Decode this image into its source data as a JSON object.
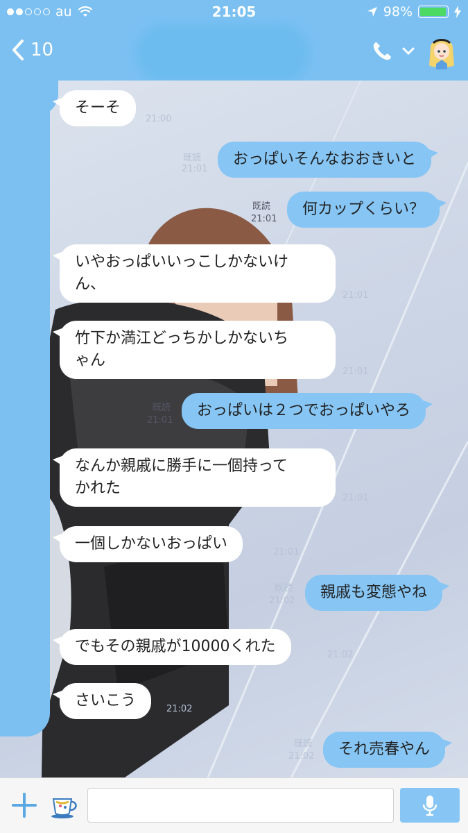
{
  "status_bar": {
    "carrier": "au",
    "signal_bars_filled": 2,
    "signal_bars_total": 5,
    "time": "21:05",
    "battery": "98%",
    "battery_level": 0.98
  },
  "header": {
    "back_count": "10"
  },
  "messages": [
    {
      "dir": "in",
      "text": "そーそ",
      "time": "21:00",
      "read": ""
    },
    {
      "dir": "out",
      "text": "おっぱいそんなおおきいと",
      "time": "21:01",
      "read": "既読"
    },
    {
      "dir": "out",
      "text": "何カップくらい？",
      "time": "21:01",
      "read": "既読"
    },
    {
      "dir": "in",
      "text": "いやおっぱいいっこしかないけ\nん、",
      "time": "21:01",
      "read": ""
    },
    {
      "dir": "in",
      "text": "竹下か満江どっちかしかないち\nゃん",
      "time": "21:01",
      "read": ""
    },
    {
      "dir": "out",
      "text": "おっぱいは２つでおっぱいやろ",
      "time": "21:01",
      "read": "既読"
    },
    {
      "dir": "in",
      "text": "なんか親戚に勝手に一個持って\nかれた",
      "time": "21:01",
      "read": ""
    },
    {
      "dir": "in",
      "text": "一個しかないおっぱい",
      "time": "21:01",
      "read": ""
    },
    {
      "dir": "out",
      "text": "親戚も変態やね",
      "time": "21:02",
      "read": "既読"
    },
    {
      "dir": "in",
      "text": "でもその親戚が10000くれた",
      "time": "21:02",
      "read": ""
    },
    {
      "dir": "in",
      "text": "さいこう",
      "time": "21:02",
      "read": ""
    },
    {
      "dir": "out",
      "text": "それ売春やん",
      "time": "21:02",
      "read": "既読"
    }
  ],
  "input_bar": {
    "placeholder": ""
  },
  "icons": {
    "back": "chevron-left-icon",
    "phone": "phone-icon",
    "menu": "chevron-down-icon",
    "avatar": "alice-avatar-icon",
    "plus": "plus-icon",
    "sticker": "teacup-sticker-icon",
    "mic": "microphone-icon",
    "location": "location-arrow-icon",
    "wifi": "wifi-icon",
    "charging": "bolt-icon"
  },
  "colors": {
    "accent": "#7cc0f2",
    "outgoing_bubble": "#86c5f4",
    "incoming_bubble": "#ffffff",
    "battery_fill": "#4cd964"
  }
}
